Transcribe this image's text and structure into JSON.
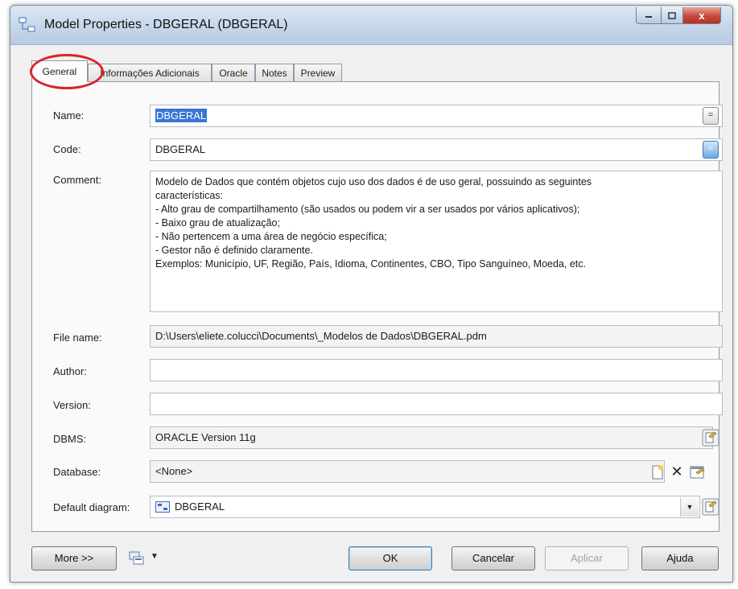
{
  "window": {
    "title": "Model Properties - DBGERAL (DBGERAL)",
    "icons": {
      "app": "model-icon",
      "minimize": "minimize-icon",
      "maximize": "maximize-icon",
      "close": "close-icon"
    },
    "close_glyph": "x"
  },
  "tabs": [
    {
      "label": "General",
      "active": true
    },
    {
      "label": "Informações Adicionais",
      "active": false
    },
    {
      "label": "Oracle",
      "active": false
    },
    {
      "label": "Notes",
      "active": false
    },
    {
      "label": "Preview",
      "active": false
    }
  ],
  "form": {
    "name": {
      "label": "Name:",
      "value": "DBGERAL"
    },
    "code": {
      "label": "Code:",
      "value": "DBGERAL"
    },
    "comment": {
      "label": "Comment:",
      "lines": [
        "Modelo de Dados que contém objetos cujo uso dos dados é de uso geral, possuindo as seguintes",
        "características:",
        "- Alto grau de compartilhamento (são usados ou podem vir a ser usados por vários aplicativos);",
        "- Baixo grau de atualização;",
        "- Não pertencem a uma área de negócio específica;",
        "- Gestor não é definido claramente.",
        "Exemplos: Município, UF, Região, País, Idioma, Continentes, CBO, Tipo Sanguíneo, Moeda, etc."
      ]
    },
    "file_name": {
      "label": "File name:",
      "value": "D:\\Users\\eliete.colucci\\Documents\\_Modelos de Dados\\DBGERAL.pdm"
    },
    "author": {
      "label": "Author:",
      "value": ""
    },
    "version": {
      "label": "Version:",
      "value": ""
    },
    "dbms": {
      "label": "DBMS:",
      "value": "ORACLE Version 11g"
    },
    "database": {
      "label": "Database:",
      "value": "<None>"
    },
    "default_diagram": {
      "label": "Default diagram:",
      "value": "DBGERAL"
    },
    "mini_button_glyph": "=",
    "delete_glyph": "✕",
    "dropdown_glyph": "▼"
  },
  "buttons": {
    "more": "More >>",
    "ok": "OK",
    "cancel": "Cancelar",
    "apply": "Aplicar",
    "help": "Ajuda"
  },
  "colors": {
    "highlight_ring": "#d9252b",
    "selection": "#3875d7"
  }
}
